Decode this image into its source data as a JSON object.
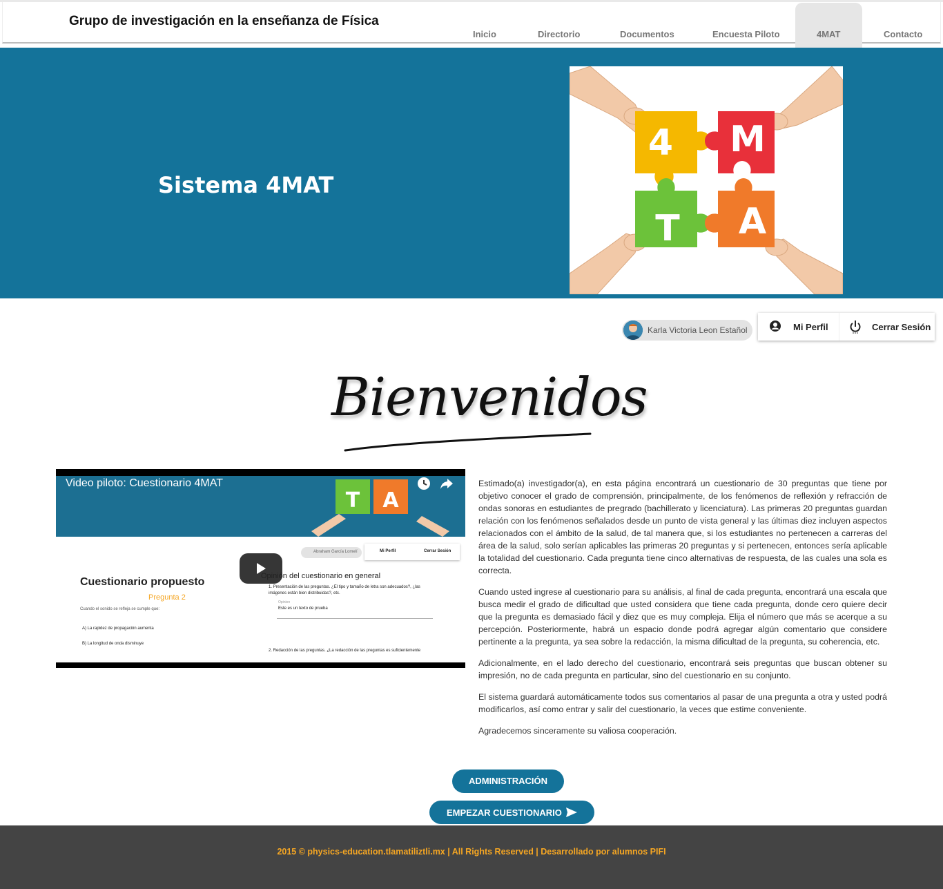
{
  "header": {
    "site_title": "Grupo de investigación en la enseñanza de Física",
    "nav": [
      {
        "label": "Inicio"
      },
      {
        "label": "Directorio"
      },
      {
        "label": "Documentos"
      },
      {
        "label": "Encuesta Piloto"
      },
      {
        "label": "4MAT",
        "active": true
      },
      {
        "label": "Contacto"
      }
    ]
  },
  "hero": {
    "title": "Sistema 4MAT",
    "puzzle_letters": [
      "4",
      "M",
      "T",
      "A"
    ]
  },
  "user": {
    "name": "Karla Victoria Leon Estañol",
    "profile_label": "Mi Perfil",
    "logout_label": "Cerrar Sesión"
  },
  "welcome": {
    "text": "Bienvenidos"
  },
  "video": {
    "title": "Video piloto: Cuestionario 4MAT",
    "thumb": {
      "user_name": "Abraham García Lomelí",
      "profile": "Mi Perfil",
      "logout": "Cerrar Sesión",
      "heading": "Cuestionario propuesto",
      "question": "Pregunta 2",
      "prompt": "Cuando el sonido se refleja se cumple que:",
      "option_a": "A) La rapidez de propagación aumenta",
      "option_b": "B) La longitud de onda disminuye",
      "opinion_title": "Opinión del cuestionario en general",
      "opinion_q1": "1. Presentación de las preguntas. ¿El tipo y tamaño de letra son adecuados?, ¿las imágenes están bien distribuidas?, etc.",
      "opinion_hint": "Opinion",
      "opinion_answer": "Este es un texto de prueba",
      "opinion_q2": "2. Redacción de las preguntas. ¿La redacción de las preguntas es suficientemente"
    }
  },
  "description": {
    "p1": "Estimado(a) investigador(a), en esta página encontrará un cuestionario de 30 preguntas que tiene por objetivo conocer el grado de comprensión, principalmente, de los fenómenos de reflexión y refracción de ondas sonoras en estudiantes de pregrado (bachillerato y licenciatura). Las primeras 20 preguntas guardan relación con los fenómenos señalados desde un punto de vista general y las últimas diez incluyen aspectos relacionados con el ámbito de la salud, de tal manera que, si los estudiantes no pertenecen a carreras del área de la salud, solo serían aplicables las primeras 20 preguntas y si pertenecen, entonces sería aplicable la totalidad del cuestionario. Cada pregunta tiene cinco alternativas de respuesta, de las cuales una sola es correcta.",
    "p2": "Cuando usted ingrese al cuestionario para su análisis, al final de cada pregunta, encontrará una escala que busca medir el grado de dificultad que usted considera que tiene cada pregunta, donde cero quiere decir que la pregunta es demasiado fácil y diez que es muy compleja. Elija el número que más se acerque a su percepción. Posteriormente, habrá un espacio donde podrá agregar algún comentario que considere pertinente a la pregunta, ya sea sobre la redacción, la misma dificultad de la pregunta, su coherencia, etc.",
    "p3": "Adicionalmente, en el lado derecho del cuestionario, encontrará seis preguntas que buscan obtener su impresión, no de cada pregunta en particular, sino del cuestionario en su conjunto.",
    "p4": "El sistema guardará automáticamente todos sus comentarios al pasar de una pregunta a otra y usted podrá modificarlos, así como entrar y salir del cuestionario, la veces que estime conveniente.",
    "p5": "Agradecemos sinceramente su valiosa cooperación."
  },
  "buttons": {
    "admin": "ADMINISTRACIÓN",
    "start": "EMPEZAR CUESTIONARIO"
  },
  "footer": {
    "text": "2015 © physics-education.tlamatiliztli.mx | All Rights Reserved | Desarrollado por alumnos PIFI"
  },
  "colors": {
    "primary": "#14739a",
    "footer_bg": "#444444",
    "footer_text": "#f5a623",
    "puzzle_yellow": "#f5b800",
    "puzzle_red": "#e8303a",
    "puzzle_green": "#6cc23a",
    "puzzle_orange": "#f07a2a"
  }
}
